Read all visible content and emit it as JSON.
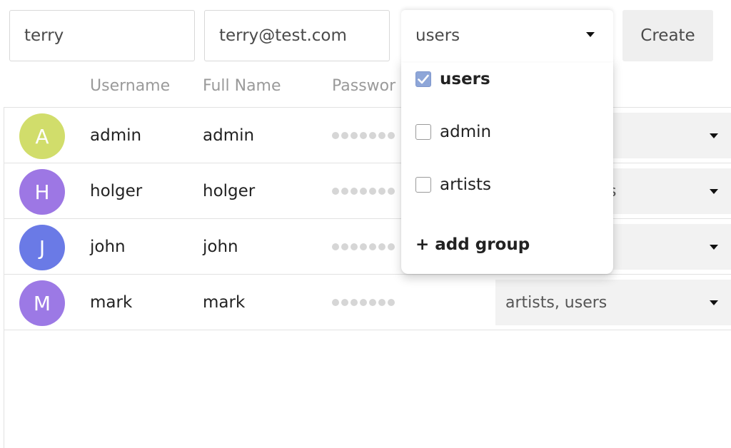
{
  "form": {
    "username_value": "terry",
    "email_value": "terry@test.com",
    "group_value": "users",
    "create_label": "Create"
  },
  "header": {
    "username": "Username",
    "full_name": "Full Name",
    "password": "Passwor"
  },
  "rows": [
    {
      "initial": "A",
      "username": "admin",
      "full_name": "admin",
      "groups": "",
      "avatar_color": "#d1dd6b"
    },
    {
      "initial": "H",
      "username": "holger",
      "full_name": "holger",
      "groups": "s",
      "avatar_color": "#9d77e4"
    },
    {
      "initial": "J",
      "username": "john",
      "full_name": "john",
      "groups": "",
      "avatar_color": "#6a7ae6"
    },
    {
      "initial": "M",
      "username": "mark",
      "full_name": "mark",
      "groups": "artists, users",
      "avatar_color": "#9c79e5"
    }
  ],
  "dropdown": {
    "options": [
      {
        "label": "users",
        "checked": true
      },
      {
        "label": "admin",
        "checked": false
      },
      {
        "label": "artists",
        "checked": false
      }
    ],
    "add_group_label": "+ add group"
  },
  "icons": {
    "caret": "caret-down-icon",
    "checkmark": "checkmark-icon"
  }
}
